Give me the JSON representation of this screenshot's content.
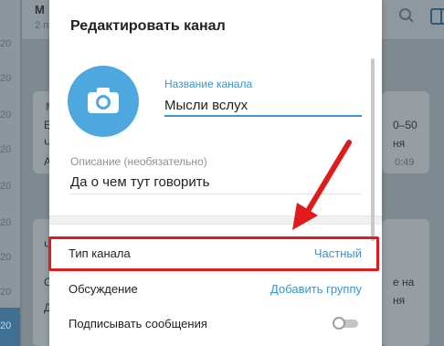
{
  "background": {
    "header_title": "М",
    "header_subtitle": "2 п",
    "sidebar_times": [
      "20",
      "20",
      "20",
      "20",
      "20",
      "20",
      "20",
      "20"
    ],
    "selected_time": "20",
    "bubble1_name": "М",
    "bubble1_lines": [
      "Е",
      "Ч",
      "А"
    ],
    "bubble1_right": "0–50",
    "bubble1_right2": "ня",
    "bubble1_time": "0:49",
    "bubble2_lines": [
      "Ч",
      "С",
      "Д"
    ],
    "bubble2_right": "е на",
    "bubble2_right2": "ня"
  },
  "dialog": {
    "title": "Редактировать канал",
    "name_label": "Название канала",
    "name_value": "Мысли вслух",
    "description_label": "Описание (необязательно)",
    "description_value": "Да о чем тут говорить",
    "rows": [
      {
        "label": "Тип канала",
        "value": "Частный"
      },
      {
        "label": "Обсуждение",
        "value": "Добавить группу"
      },
      {
        "label": "Подписывать сообщения",
        "value": ""
      }
    ],
    "sign_messages_enabled": false
  },
  "colors": {
    "accent": "#3a95d3",
    "avatar": "#4fa7e0",
    "annotation_red": "#e01b1b"
  },
  "icons": {
    "avatar": "camera-icon",
    "search": "search-icon",
    "panel": "sidebar-panel-icon"
  }
}
